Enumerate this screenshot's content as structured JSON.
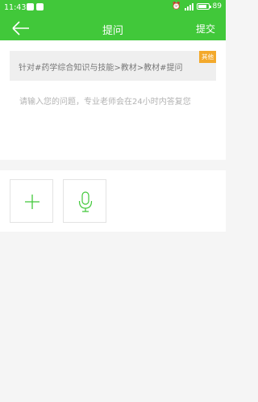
{
  "status_bar": {
    "time": "11:43",
    "battery": "89",
    "battery_level": 0.89
  },
  "header": {
    "title": "提问",
    "submit_label": "提交"
  },
  "topic": {
    "text": "针对#药学综合知识与技能>教材>教材#提问",
    "tag": "其他"
  },
  "question": {
    "placeholder": "请输入您的问题，专业老师会在24小时内答复您"
  },
  "attachments": [
    {
      "icon": "plus-icon"
    },
    {
      "icon": "microphone-icon"
    }
  ],
  "colors": {
    "brand": "#41c83a",
    "tag": "#f3a92c"
  }
}
